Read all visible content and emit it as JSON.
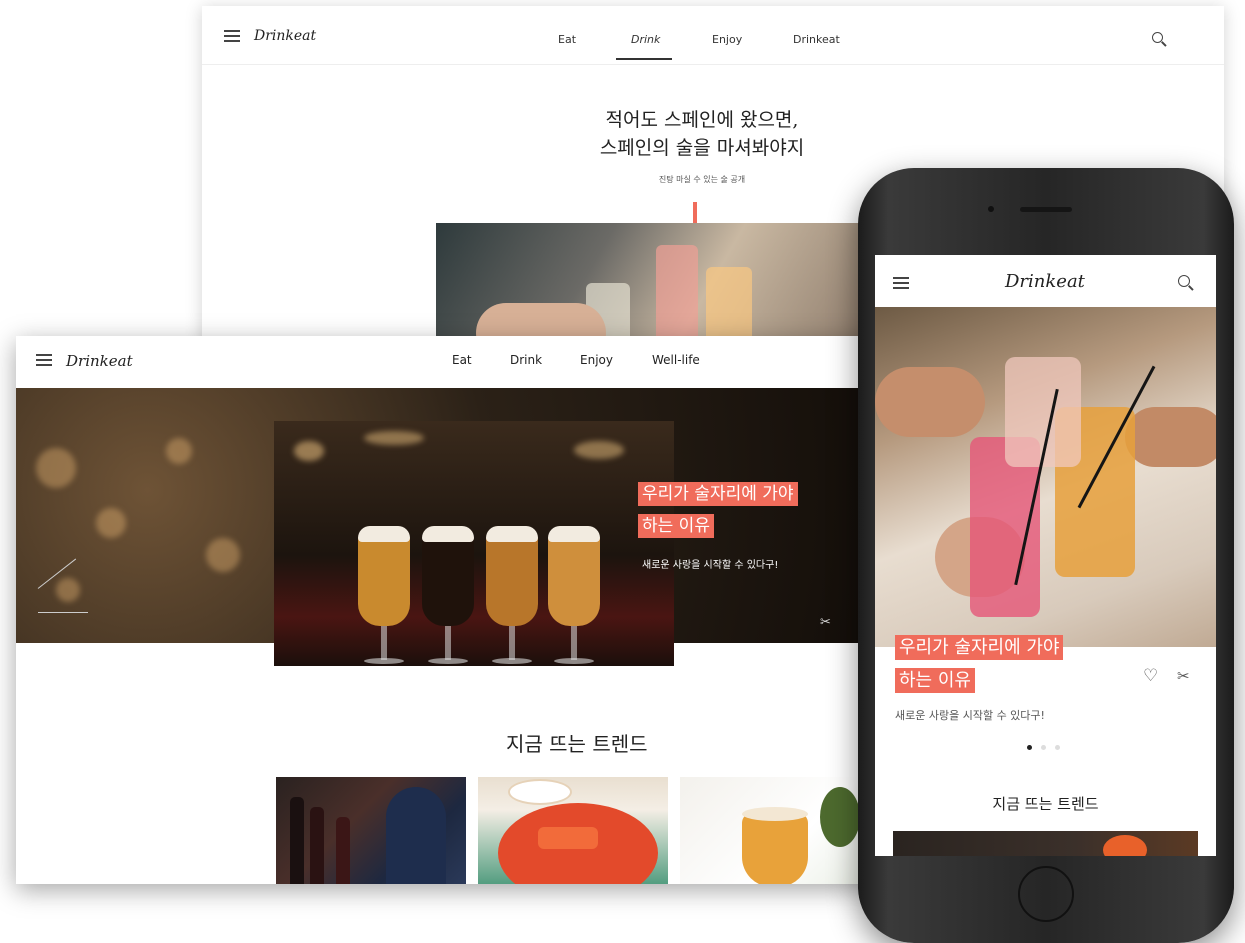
{
  "back_site": {
    "logo": "Drinkeat",
    "nav": [
      "Eat",
      "Drink",
      "Enjoy",
      "Drinkeat"
    ],
    "active_nav": "Drink",
    "headline_line1": "적어도 스페인에 왔으면,",
    "headline_line2": "스페인의 술을 마셔봐야지",
    "subtitle": "진탕 마실 수 있는 술 공개"
  },
  "front_site": {
    "logo": "Drinkeat",
    "nav": [
      "Eat",
      "Drink",
      "Enjoy",
      "Well-life"
    ],
    "hero_title_line1": "우리가 술자리에 가야",
    "hero_title_line2": "하는 이유",
    "hero_subtitle": "새로운 사랑을 시작할 수 있다구!",
    "trend_title": "지금 뜨는 트렌드"
  },
  "mobile_site": {
    "logo": "Drinkeat",
    "hero_title_line1": "우리가 술자리에 가야",
    "hero_title_line2": "하는 이유",
    "hero_subtitle": "새로운 사랑을 시작할 수 있다구!",
    "trend_title": "지금 뜨는 트렌드",
    "carousel_current": 1,
    "carousel_total": 3
  },
  "colors": {
    "accent": "#f06c5b",
    "phone_body": "#2a2a2a"
  },
  "icons": [
    "hamburger-menu-icon",
    "search-icon",
    "share-icon",
    "heart-icon",
    "prev-arrow-icon"
  ]
}
